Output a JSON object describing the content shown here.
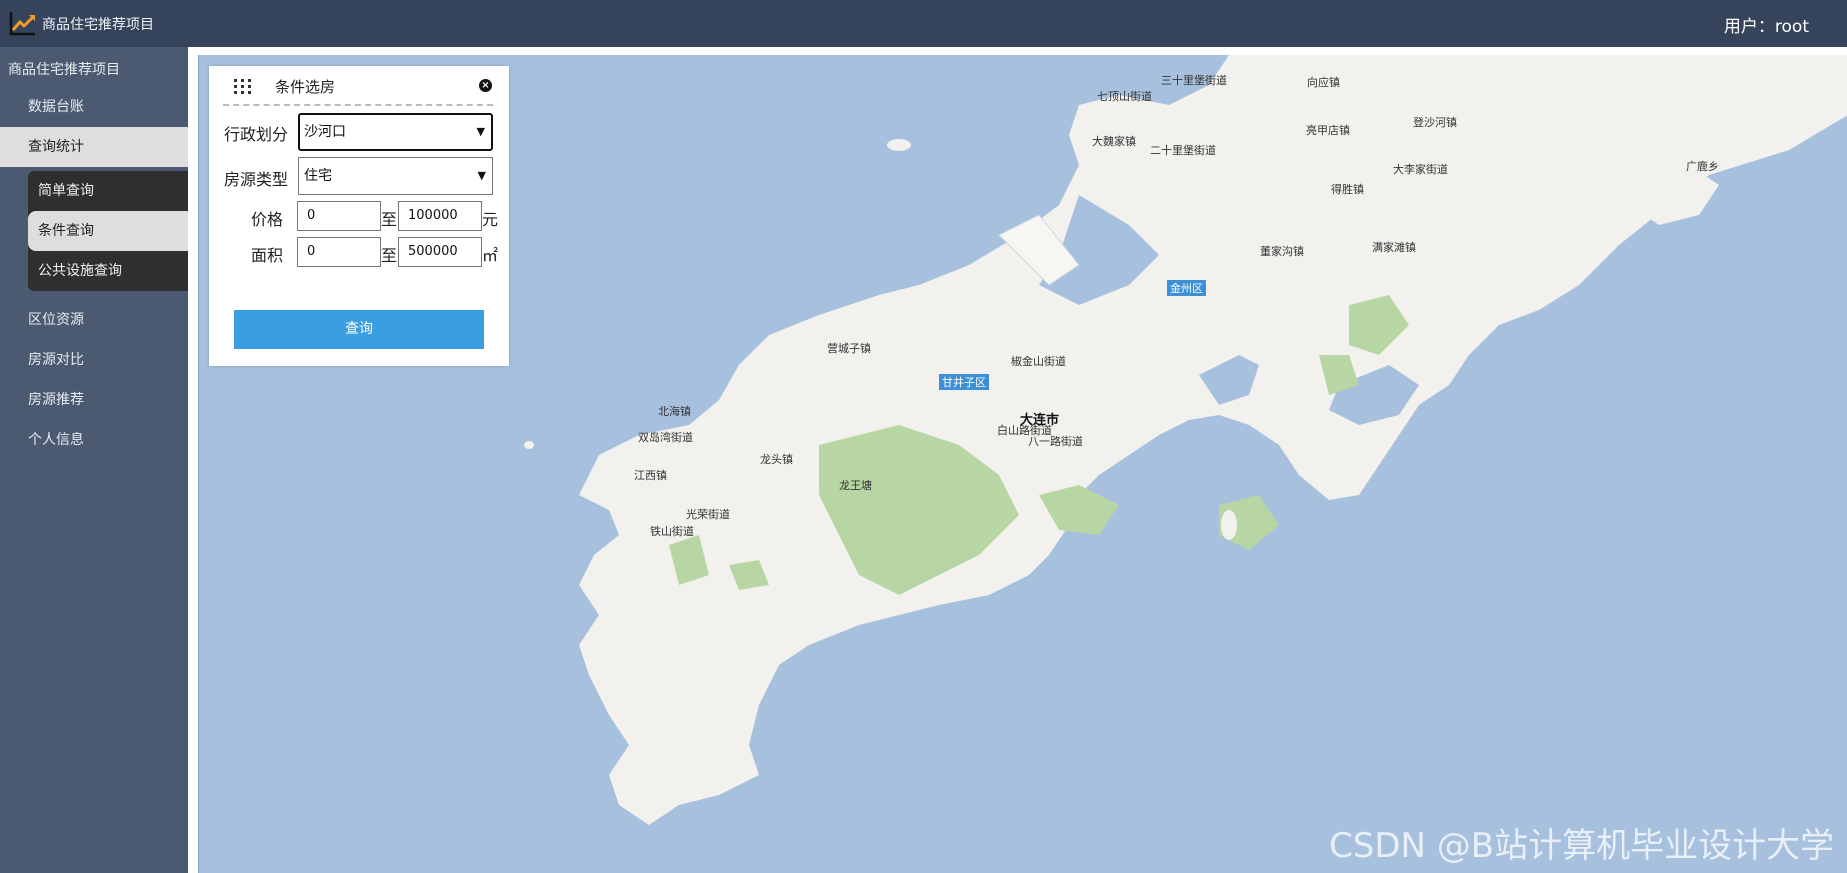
{
  "app": {
    "title": "商品住宅推荐项目",
    "user_label": "用户：root"
  },
  "sidebar": {
    "root": "商品住宅推荐项目",
    "items": [
      {
        "label": "数据台账",
        "active": false
      },
      {
        "label": "查询统计",
        "active": true
      },
      {
        "label": "区位资源",
        "active": false
      },
      {
        "label": "房源对比",
        "active": false
      },
      {
        "label": "房源推荐",
        "active": false
      },
      {
        "label": "个人信息",
        "active": false
      }
    ],
    "submenu": [
      {
        "label": "简单查询",
        "active": false
      },
      {
        "label": "条件查询",
        "active": true
      },
      {
        "label": "公共设施查询",
        "active": false
      }
    ]
  },
  "panel": {
    "title": "条件选房",
    "district_label": "行政划分",
    "district_value": "沙河口",
    "type_label": "房源类型",
    "type_value": "住宅",
    "price_label": "价格",
    "price_min": "0",
    "price_max": "100000",
    "price_unit": "元",
    "area_label": "面积",
    "area_min": "0",
    "area_max": "500000",
    "area_unit": "㎡",
    "range_sep": "至",
    "query_label": "查询"
  },
  "map": {
    "labels": {
      "sanshili": "三十里堡街道",
      "xiangying": "向应镇",
      "qiding": "七顶山街道",
      "dengsha": "登沙河镇",
      "liangjia": "亮甲店镇",
      "dawei": "大魏家镇",
      "ershili": "二十里堡街道",
      "guanglu": "广鹿乡",
      "dali": "大李家街道",
      "desheng": "得胜镇",
      "xingjia": "董家沟镇",
      "manjia": "满家滩镇",
      "jinzhou": "金州区",
      "yingcheng": "营城子镇",
      "jiaojin": "椒金山街道",
      "ganjingzi": "甘井子区",
      "beihai": "北海镇",
      "dalian": "大连市",
      "baishan": "白山路街道",
      "bayi": "八一路街道",
      "shuangdao": "双岛湾街道",
      "longtou": "龙头镇",
      "jiangxi": "江西镇",
      "longwang": "龙王塘",
      "guangrong": "光荣街道",
      "tieshan": "铁山街道"
    }
  },
  "watermark": "CSDN @B站计算机毕业设计大学",
  "colors": {
    "topbar": "#35445a",
    "sidebar": "#4b5a70",
    "accent": "#3a9ee0",
    "sea": "#a7c0de",
    "land": "#f2f1ee",
    "park": "#b8d6a3"
  }
}
